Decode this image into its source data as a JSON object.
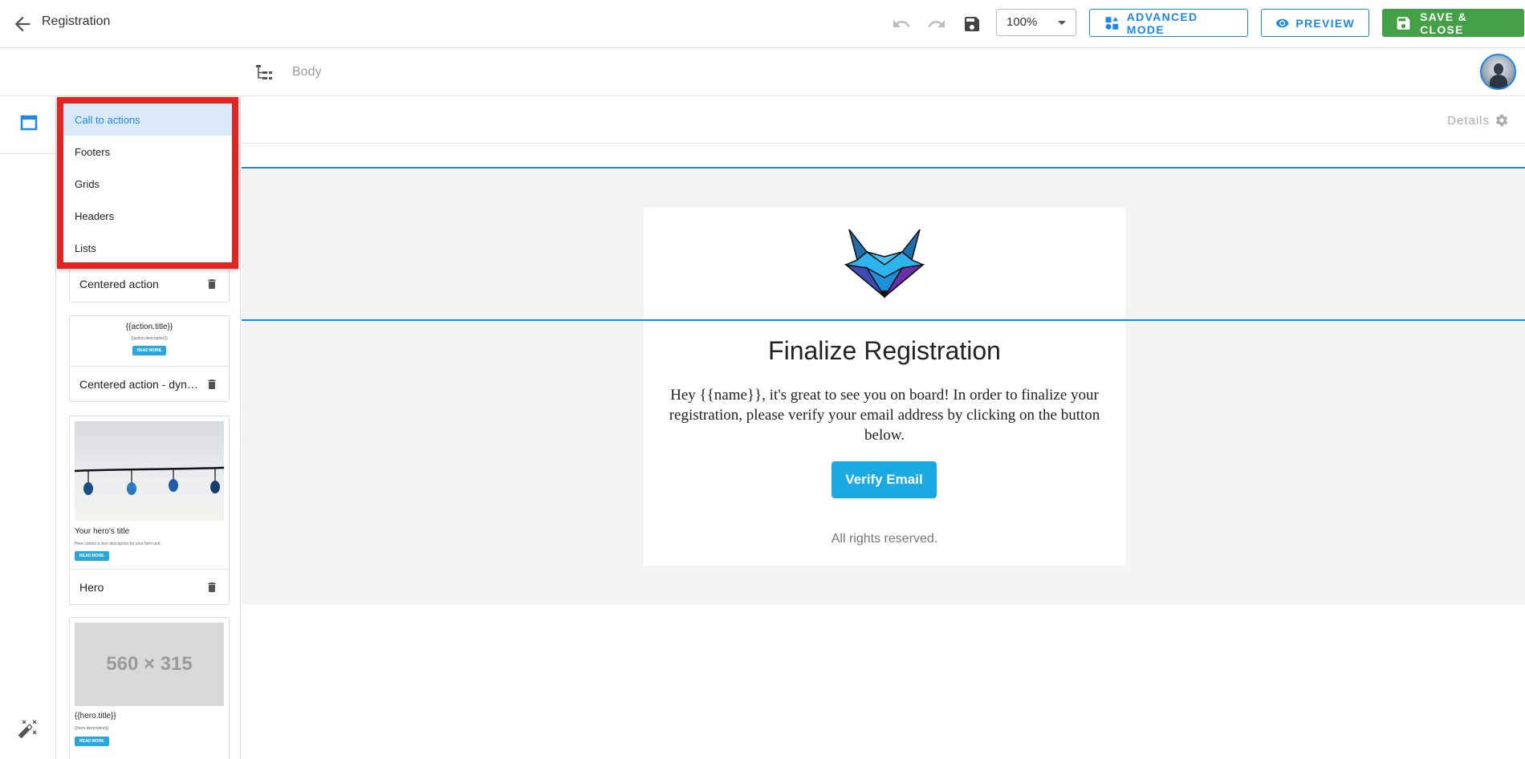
{
  "header": {
    "title": "Registration",
    "zoom": "100%",
    "advanced_mode_label": "ADVANCED MODE",
    "preview_label": "PREVIEW",
    "save_close_label": "SAVE & CLOSE"
  },
  "subbar": {
    "breadcrumb": "Body"
  },
  "block_menu": {
    "items": [
      {
        "label": "Call to actions",
        "active": true
      },
      {
        "label": "Footers"
      },
      {
        "label": "Grids"
      },
      {
        "label": "Headers"
      },
      {
        "label": "Lists"
      }
    ]
  },
  "blocks": {
    "centered_action": {
      "name": "Centered action"
    },
    "centered_dynamic": {
      "name": "Centered action - dynamic",
      "preview_title": "{{action.title}}",
      "preview_desc": "{{action.description}}",
      "preview_btn": "READ MORE"
    },
    "hero": {
      "name": "Hero",
      "preview_title": "Your hero's title",
      "preview_desc": "Here comes a nice description for your hero unit.",
      "preview_btn": "READ MORE"
    },
    "hero_dynamic": {
      "placeholder_size": "560 × 315",
      "preview_title": "{{hero.title}}",
      "preview_desc": "{{hero.description}}",
      "preview_btn": "READ MORE"
    }
  },
  "canvas": {
    "details_label": "Details"
  },
  "email": {
    "title": "Finalize Registration",
    "body": "Hey {{name}}, it's great to see you on board! In order to finalize your registration, please verify your email address by clicking on the button below.",
    "button": "Verify Email",
    "footer": "All rights reserved."
  },
  "colors": {
    "accent": "#1e88e5",
    "save": "#43a047",
    "highlight": "#e52421",
    "email_button": "#19a9e3"
  }
}
